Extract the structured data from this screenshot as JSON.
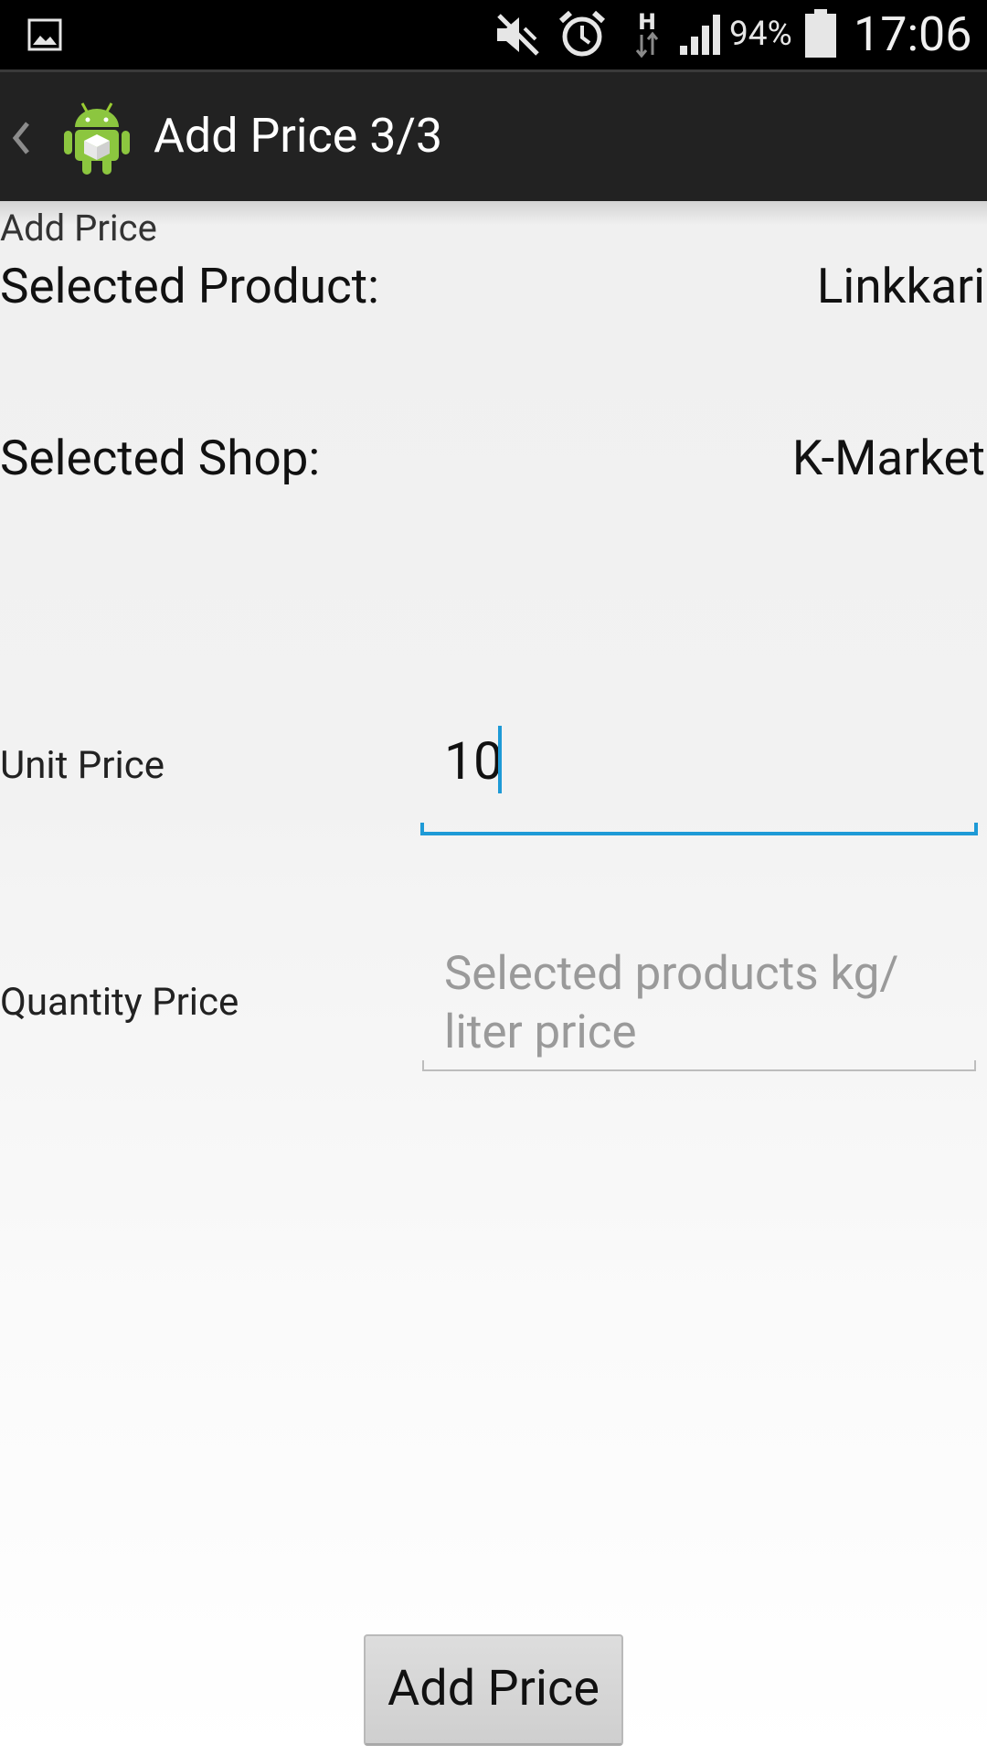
{
  "status_bar": {
    "battery_percent": "94%",
    "time": "17:06",
    "icons": [
      "gallery-icon",
      "mute-icon",
      "alarm-icon",
      "hspa-data-icon",
      "signal-icon",
      "battery-icon"
    ]
  },
  "action_bar": {
    "title": "Add Price 3/3",
    "up_icon": "chevron-left-icon",
    "app_icon": "android-app-icon"
  },
  "content": {
    "header_label": "Add Price",
    "selected_product": {
      "label": "Selected Product:",
      "value": "Linkkari"
    },
    "selected_shop": {
      "label": "Selected Shop:",
      "value": "K-Market"
    },
    "unit_price": {
      "label": "Unit Price",
      "value": "10"
    },
    "quantity_price": {
      "label": "Quantity Price",
      "value": "",
      "placeholder": "Selected products kg/ liter price"
    },
    "add_button_label": "Add Price"
  },
  "colors": {
    "accent": "#1e9ad6",
    "action_bar_bg": "#222222",
    "status_bar_bg": "#000000"
  }
}
